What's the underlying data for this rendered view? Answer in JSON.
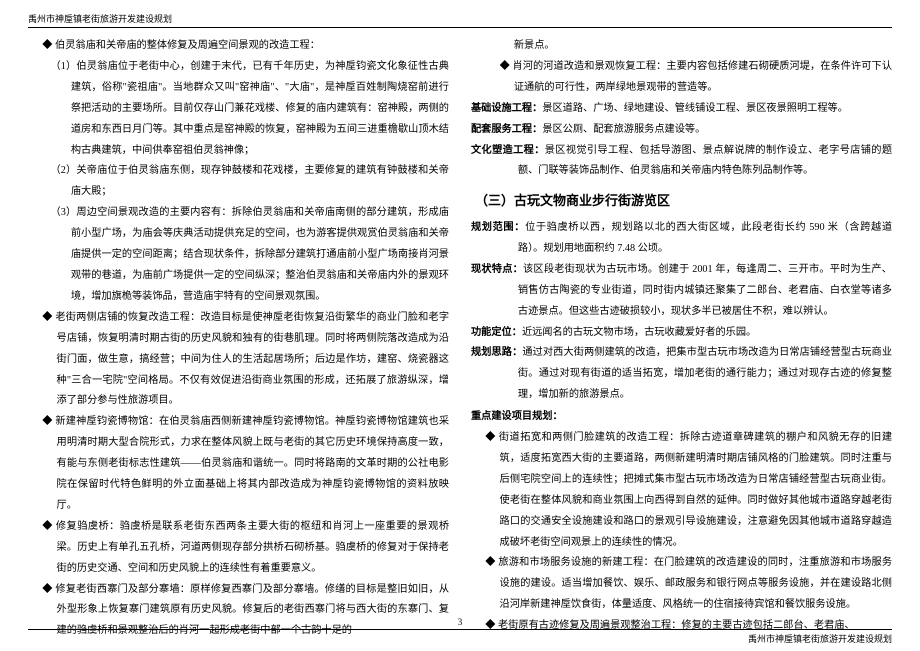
{
  "header": {
    "title": "禹州市神垕镇老街旅游开发建设规划"
  },
  "footer": {
    "page": "3",
    "title": "禹州市神垕镇老街旅游开发建设规划"
  },
  "left": {
    "d1": "伯灵翁庙和关帝庙的整体修复及周遍空间景观的改造工程：",
    "n1": "（1）伯灵翁庙位于老街中心，创建于末代，已有千年历史，为神垕钧瓷文化象征性古典建筑，俗称\"瓷祖庙\"。当地群众又叫\"窑神庙\"、\"大庙\"，是神垕百姓制陶烧窑前进行祭把活动的主要场所。目前仅存山门兼花戏楼、修复的庙内建筑有：窑神殿，两侧的道房和东西日月门等。其中重点是窑神殿的恢复，窑神殿为五间三进重檐歇山顶木结构古典建筑，中间供奉窑祖伯灵翁神像；",
    "n2": "（2）关帝庙位于伯灵翁庙东侧，现存钟鼓楼和花戏楼，主要修复的建筑有钟鼓楼和关帝庙大殿；",
    "n3": "（3）周边空间景观改造的主要内容有：拆除伯灵翁庙和关帝庙南侧的部分建筑，形成庙前小型广场，为庙会等庆典活动提供充足的空间，也为游客提供观赏伯灵翁庙和关帝庙提供一定的空间距离；结合现状条件，拆除部分建筑打通庙前小型广场南接肖河景观带的巷道，为庙前广场提供一定的空间纵深；整治伯灵翁庙和关帝庙内外的景观环境，增加旗桅等装饰品，营造庙宇特有的空间景观氛围。",
    "d2": "老街两侧店铺的恢复改造工程：改造目标是使神垕老街恢复沿街繁华的商业门脸和老字号店铺，恢复明清时期古街的历史风貌和独有的街巷肌理。同时将两侧院落改造成为沿街门面，做生意，搞经营；中间为住人的生活起居场所；后边是作坊，建窑、烧瓷器这种\"三合一宅院\"空间格局。不仅有效促进沿街商业氛围的形成，还拓展了旅游纵深，增添了部分参与性旅游项目。",
    "d3": "新建神垕钧瓷博物馆：在伯灵翁庙西侧新建神垕钧瓷博物馆。神垕钧瓷博物馆建筑也采用明清时期大型合院形式，力求在整体风貌上既与老街的其它历史环境保持高度一致，有能与东侧老街标志性建筑——伯灵翁庙和谐统一。同时将路南的文革时期的公社电影院在保留时代特色鲜明的外立面基础上将其内部改造成为神垕钧瓷博物馆的资料放映厅。",
    "d4": "修复驺虞桥：驺虞桥是联系老街东西两条主要大街的枢纽和肖河上一座重要的景观桥梁。历史上有单孔五孔桥，河道两侧现存部分拱桥石砌桥基。驺虞桥的修复对于保持老街的历史交通、空间和历史风貌上的连续性有着重要意义。",
    "d5": "修复老街西寨门及部分寨墙：原样修复西寨门及部分寨墙。修缮的目标是整旧如旧，从外型形象上恢复寨门建筑原有历史风貌。修复后的老街西寨门将与西大街的东寨门、复建的驺虞桥和景观整治后的肖河一起形成老街中部一个古韵十足的"
  },
  "right": {
    "top_cont": "新景点。",
    "d_top": "肖河的河道改造和景观恢复工程：主要内容包括修建石砌硬质河堤，在条件许可下认证通航的可行性，两岸绿地景观带的营造等。",
    "kv1_k": "基础设施工程：",
    "kv1_v": "景区道路、广场、绿地建设、管线铺设工程、景区夜景照明工程等。",
    "kv2_k": "配套服务工程：",
    "kv2_v": "景区公厕、配套旅游服务点建设等。",
    "kv3_k": "文化塑造工程：",
    "kv3_v": "景区视觉引导工程、包括导游图、景点解说牌的制作设立、老字号店铺的题额、门联等装饰品制作、伯灵翁庙和关帝庙内特色陈列品制作等。",
    "h2": "（三）古玩文物商业步行街游览区",
    "r_kv1_k": "规划范围：",
    "r_kv1_v": "位于驺虞桥以西，规划路以北的西大街区域，此段老街长约 590 米（含跨越道路）。规划用地面积约 7.48 公顷。",
    "r_kv2_k": "现状特点：",
    "r_kv2_v": "该区段老街现状为古玩市场。创建于 2001 年，每逢周二、三开市。平时为生产、销售仿古陶瓷的专业街道，同时街内城镇还聚集了二郎台、老君庙、白衣堂等诸多古迹景点。但这些古迹破损较小，现状多半已被居住不积，难以辨认。",
    "r_kv3_k": "功能定位：",
    "r_kv3_v": "近远闻名的古玩文物市场，古玩收藏爱好者的乐园。",
    "r_kv4_k": "规划思路：",
    "r_kv4_v": "通过对西大街两侧建筑的改造，把集市型古玩市场改造为日常店铺经营型古玩商业街。通过对现有街道的适当拓宽，增加老街的通行能力；通过对现存古迹的修复整理，增加新的旅游景点。",
    "sub": "重点建设项目规划：",
    "rd1": "街道拓宽和两侧门脸建筑的改造工程：拆除古迹道章碑建筑的棚户和风貌无存的旧建筑，适度拓宽西大街的主要道路，两侧新建明清时期店铺风格的门脸建筑。同时注重与后侧宅院空间上的连续性；把摊式集市型古玩市场改造为日常店铺经营型古玩商业街。使老街在整体风貌和商业氛围上向西得到自然的延伸。同时做好其他城市道路穿越老街路口的交通安全设施建设和路口的景观引导设施建设，注意避免因其他城市道路穿越造成破坏老街空间观景上的连续性的情况。",
    "rd2": "旅游和市场服务设施的新建工程：在门脸建筑的改造建设的同时，注重旅游和市场服务设施的建设。适当增加餐饮、娱乐、邮政服务和银行网点等服务设施，并在建设路北侧沿河岸新建神垕饮食街，体量适度、风格统一的住宿接待宾馆和餐饮服务设施。",
    "rd3": "老街原有古迹修复及周遍景观整治工程：修复的主要古迹包括二郎台、老君庙、"
  }
}
